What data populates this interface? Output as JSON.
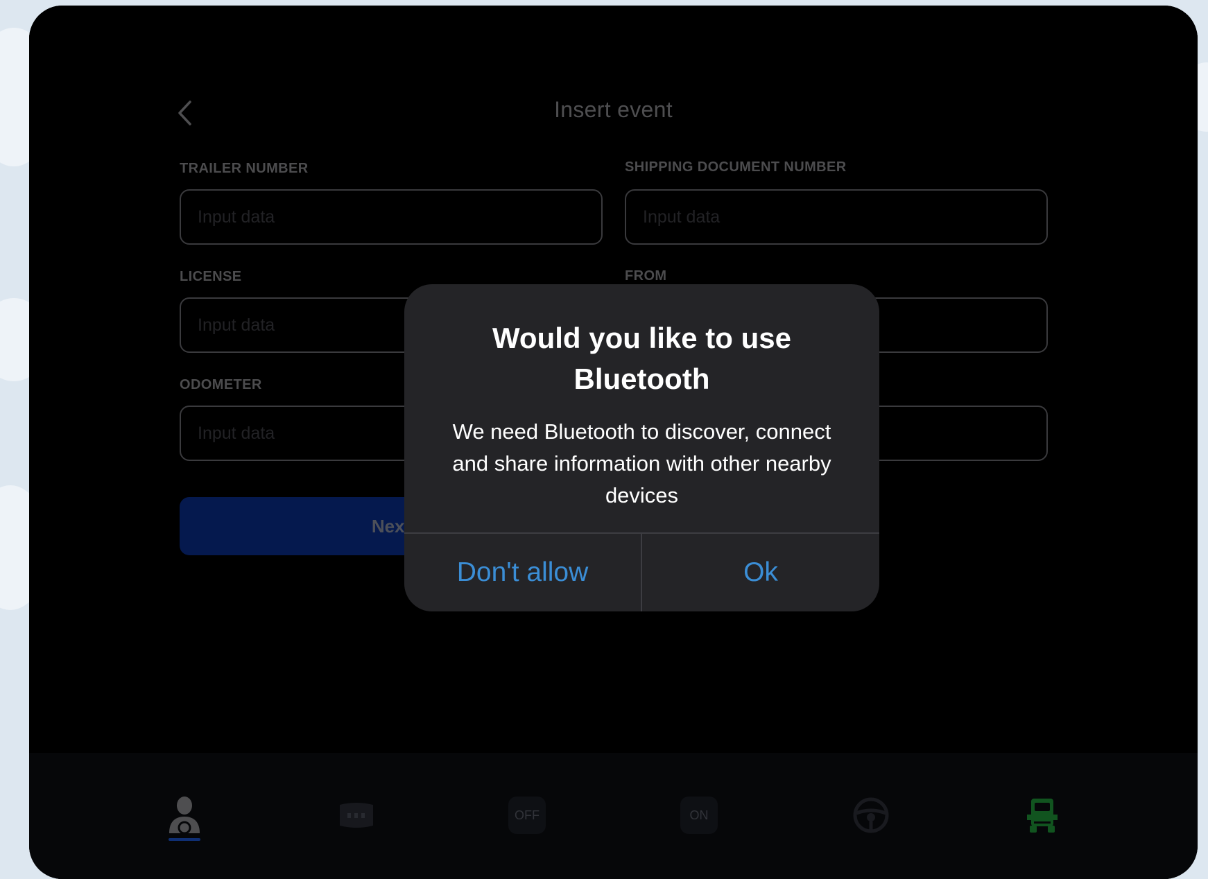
{
  "header": {
    "title": "Insert event",
    "back_icon": "chevron-left-icon"
  },
  "form": {
    "fields": [
      {
        "label": "TRAILER NUMBER",
        "placeholder": "Input data",
        "value": ""
      },
      {
        "label": "SHIPPING DOCUMENT NUMBER",
        "placeholder": "Input data",
        "value": ""
      },
      {
        "label": "LICENSE",
        "placeholder": "Input data",
        "value": ""
      },
      {
        "label": "FROM",
        "placeholder": "Input data",
        "value": ""
      },
      {
        "label": "ODOMETER",
        "placeholder": "Input data",
        "value": ""
      },
      {
        "label": "",
        "placeholder": "Input data",
        "value": ""
      }
    ],
    "next_label": "Next"
  },
  "nav": {
    "items": [
      {
        "name": "driver",
        "icon": "driver-icon",
        "active": true
      },
      {
        "name": "logs",
        "icon": "odometer-icon",
        "active": false
      },
      {
        "name": "off-duty",
        "label": "OFF",
        "active": false
      },
      {
        "name": "on-duty",
        "label": "ON",
        "active": false
      },
      {
        "name": "driving",
        "icon": "steering-wheel-icon",
        "active": false
      },
      {
        "name": "truck",
        "icon": "truck-icon",
        "active": false
      }
    ]
  },
  "dialog": {
    "title": "Would you like to use Bluetooth",
    "message": "We need Bluetooth to discover, connect and share information with other nearby devices",
    "deny_label": "Don't allow",
    "ok_label": "Ok"
  },
  "colors": {
    "primary_button": "#0a2f8f",
    "dialog_action": "#3b8ed6",
    "active_nav_indicator": "#1c57d4",
    "truck_icon": "#1f9a3a"
  }
}
